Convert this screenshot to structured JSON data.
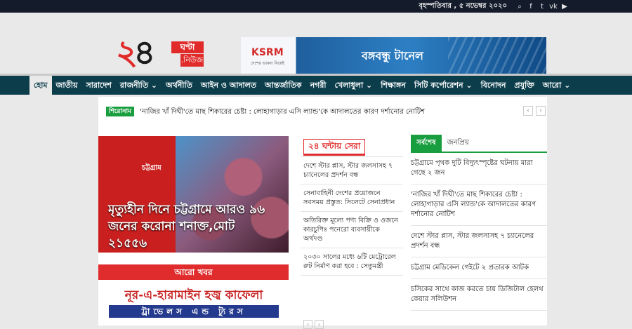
{
  "topbar": {
    "date": "বৃহস্পতিবার , ৫ নভেম্বর ২০২০",
    "social_icons": [
      "search-icon",
      "facebook-icon",
      "twitter-icon",
      "vk-icon",
      "youtube-icon"
    ],
    "social_glyphs": [
      "⌕",
      "f",
      "t",
      "vk",
      "▶"
    ]
  },
  "logo": {
    "num2": "২",
    "num4": "৪",
    "boxA": "ঘণ্টা",
    "boxB": ".নিউজ"
  },
  "banner": {
    "brand": "KSRM",
    "brand_sub": "দেশের ভাবনা নিয়েই",
    "text": "বঙ্গবন্ধু টানেল"
  },
  "nav": {
    "items": [
      "হোম",
      "জাতীয়",
      "সারাদেশ",
      "রাজনীতি ⌄",
      "অর্থনীতি",
      "আইন ও আদালত",
      "আন্তর্জাতিক",
      "নগরী",
      "খেলাধুলা ⌄",
      "শিক্ষাঙ্গন",
      "সিটি কর্পোরেশন ⌄",
      "বিনোদন",
      "প্রযুক্তি",
      "আরো ⌄"
    ]
  },
  "ticker": {
    "tag": "শিরোনাম",
    "text": "'নাজির খাঁ দিঘী'তে মাছ শিকারের চেষ্টা : লোহাগাড়ার এসি ল্যান্ড'কে আদালতের কারণ দর্শানোর নোটিশ",
    "prev": "‹",
    "next": "›"
  },
  "featured": {
    "label": "চট্টগ্রাম",
    "title": "মৃত্যুহীন দিনে চট্টগ্রামে আরও ৯৬ জনের করোনা শনাক্ত,মোট ২১৫৫৬"
  },
  "more_news": "আরো খবর",
  "ad2": {
    "line1": "নূর-এ-হারামাইন হজ্ব কাফেলা",
    "line2": "ট্রাভেলস এন্ড ট্যুরস"
  },
  "top24": {
    "heading": "২৪ ঘন্টায় সেরা",
    "items": [
      "দেশে স্টার প্লাস, স্টার জলসাসহ ৭ চ্যানেলের প্রদর্শন বন্ধ",
      "সেনাবাহিনী দেশের প্রয়োজনে সবসময় প্রস্তুত: সিলেটে সেনাপ্রধান",
      "অতিরিক্ত মূল্যে পণ্য বিক্রি ও ওজনে কারচুপিঃ পনেরো ব্যবসায়ীকে অর্থদণ্ড",
      "২০৩০ সালের মধ্যে ৬টি মেট্রোরেল রুট নির্মাণ করা হবে : সেতুমন্ত্রী"
    ],
    "prev": "‹",
    "next": "›"
  },
  "latest": {
    "tabs": [
      "সর্বশেষ",
      "জনপ্রিয়"
    ],
    "items": [
      "চট্টগ্রামে পৃথক দুটি বিদ্যুৎস্পৃষ্টের ঘটনায় মারা গেছে ২ জন",
      "'নাজির খাঁ দিঘী'তে মাছ শিকারের চেষ্টা : লোহাগাড়ার এসি ল্যান্ড'কে আদালতের কারণ দর্শানোর নোটিশ",
      "দেশে স্টার প্লাস, স্টার জলসাসহ ৭ চ্যানেলের প্রদর্শন বন্ধ",
      "চট্টগ্রাম মেডিকেল গেইটে ২ প্রতারক আটক",
      "চসিকের সাথে কাজ করতে চায় ডিজিটাল হেলথ কেয়ার সলিউশন"
    ]
  }
}
